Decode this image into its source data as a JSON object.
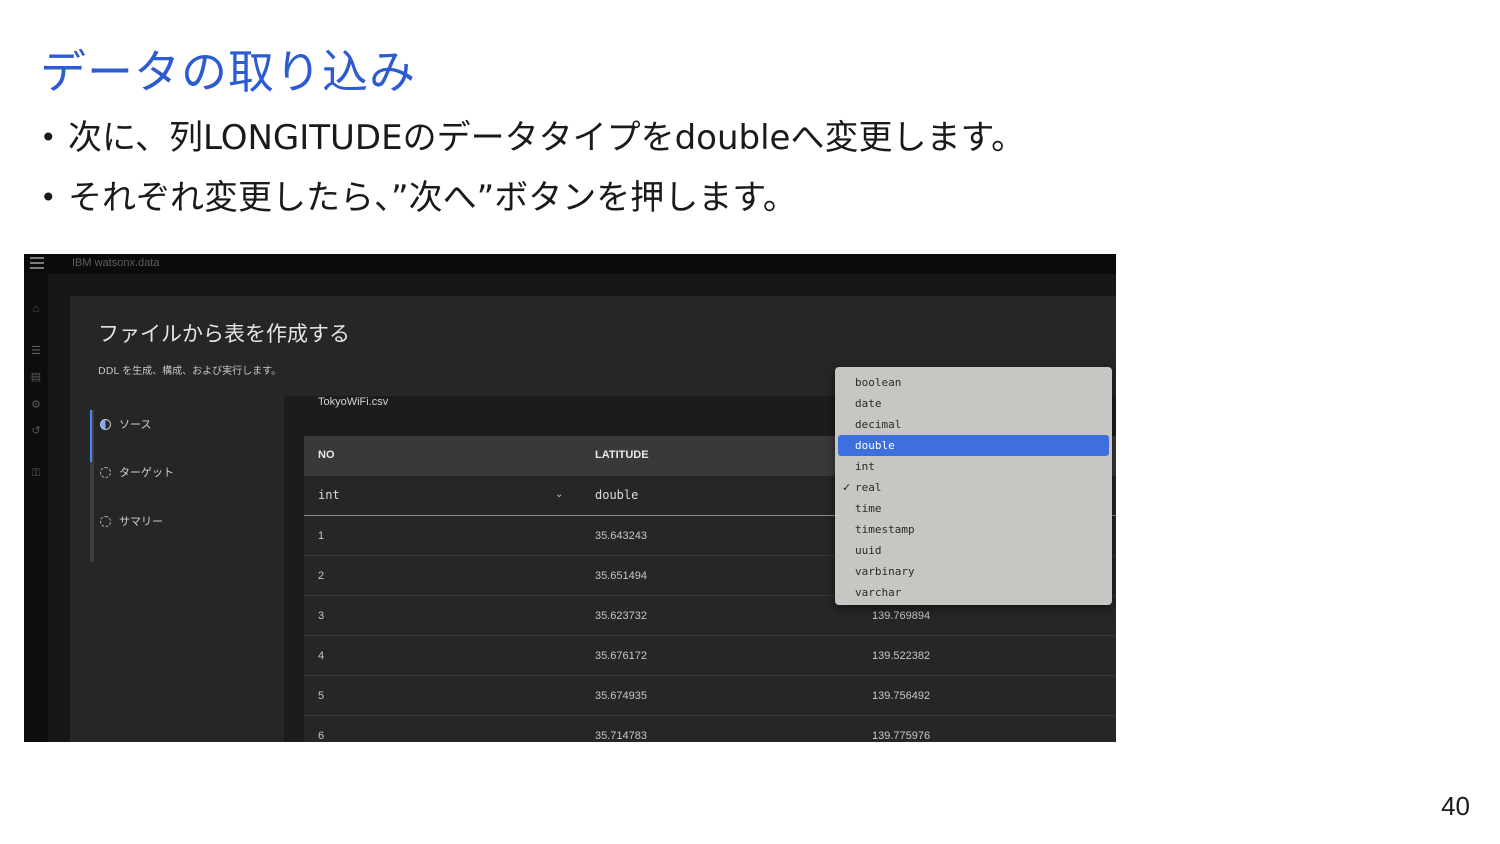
{
  "slide": {
    "title": "データの取り込み",
    "bullets": [
      "次に、列LONGITUDEのデータタイプをdoubleへ変更します。",
      "それぞれ変更したら、”次へ”ボタンを押します。"
    ],
    "page_number": "40"
  },
  "app": {
    "brand": "IBM watsonx.data",
    "dialog_title": "ファイルから表を作成する",
    "dialog_subtitle": "DDL を生成、構成、および実行します。",
    "steps": [
      {
        "label": "ソース",
        "state": "active"
      },
      {
        "label": "ターゲット",
        "state": "pending"
      },
      {
        "label": "サマリー",
        "state": "pending"
      }
    ],
    "file_name": "TokyoWiFi.csv",
    "table": {
      "headers": [
        "NO",
        "LATITUDE"
      ],
      "types": [
        "int",
        "double"
      ],
      "rows": [
        [
          "1",
          "35.643243",
          ""
        ],
        [
          "2",
          "35.651494",
          ""
        ],
        [
          "3",
          "35.623732",
          "139.769894"
        ],
        [
          "4",
          "35.676172",
          "139.522382"
        ],
        [
          "5",
          "35.674935",
          "139.756492"
        ],
        [
          "6",
          "35.714783",
          "139.775976"
        ]
      ]
    },
    "type_dropdown": {
      "options": [
        "boolean",
        "date",
        "decimal",
        "double",
        "int",
        "real",
        "time",
        "timestamp",
        "uuid",
        "varbinary",
        "varchar"
      ],
      "highlighted": "double",
      "checked": "real"
    }
  }
}
